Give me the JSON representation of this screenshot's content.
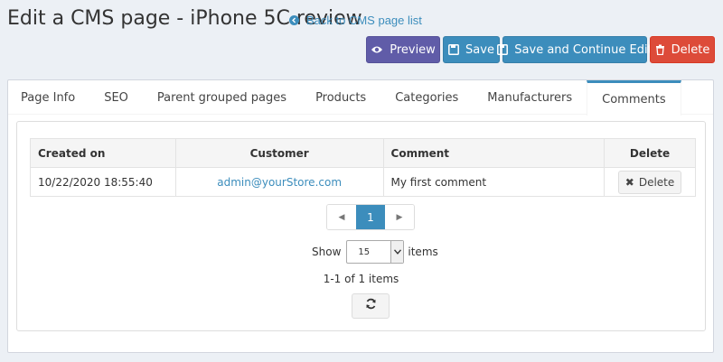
{
  "header": {
    "title": "Edit a CMS page - iPhone 5C review",
    "back_link": "Back to CMS page list"
  },
  "toolbar": {
    "preview": "Preview",
    "save": "Save",
    "save_continue": "Save and Continue Edit",
    "delete": "Delete"
  },
  "tabs": [
    {
      "label": "Page Info"
    },
    {
      "label": "SEO"
    },
    {
      "label": "Parent grouped pages"
    },
    {
      "label": "Products"
    },
    {
      "label": "Categories"
    },
    {
      "label": "Manufacturers"
    },
    {
      "label": "Comments"
    }
  ],
  "active_tab": "Comments",
  "table": {
    "columns": [
      "Created on",
      "Customer",
      "Comment",
      "Delete"
    ],
    "rows": [
      {
        "created_on": "10/22/2020 18:55:40",
        "customer": "admin@yourStore.com",
        "comment": "My first comment",
        "delete_label": "Delete"
      }
    ]
  },
  "pagination": {
    "current_page": "1",
    "show_label": "Show",
    "page_size": "15",
    "items_label": "items",
    "summary": "1-1 of 1 items"
  },
  "colors": {
    "primary": "#3c8dbc",
    "purple": "#605ca8",
    "danger": "#dd4b39"
  }
}
